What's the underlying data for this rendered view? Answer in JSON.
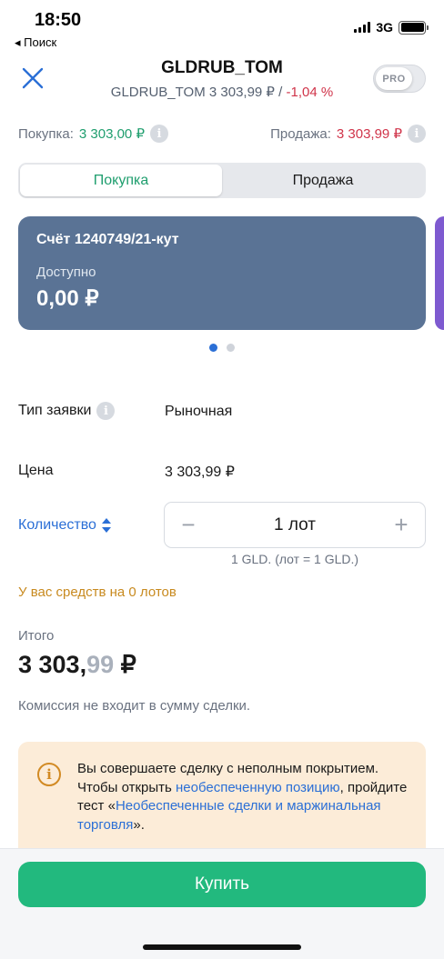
{
  "status_bar": {
    "time": "18:50",
    "back": "◂ Поиск",
    "network": "3G"
  },
  "header": {
    "title": "GLDRUB_TOM",
    "subtitle_main": "GLDRUB_TOM 3 303,99 ₽ / ",
    "subtitle_change": "-1,04 %",
    "pro_label": "PRO",
    "close_icon": "close-icon"
  },
  "prices": {
    "buy_label": "Покупка:",
    "buy_value": "3 303,00 ₽",
    "sell_label": "Продажа:",
    "sell_value": "3 303,99 ₽",
    "info_glyph": "i"
  },
  "tabs": [
    {
      "label": "Покупка",
      "active": true
    },
    {
      "label": "Продажа",
      "active": false
    }
  ],
  "account": {
    "name": "Счёт 1240749/21-кут",
    "available_label": "Доступно",
    "available_value": "0,00 ₽"
  },
  "order": {
    "type_label": "Тип заявки",
    "type_value": "Рыночная",
    "price_label": "Цена",
    "price_value": "3 303,99 ₽",
    "qty_label": "Количество",
    "qty_minus": "−",
    "qty_value": "1 лот",
    "qty_plus": "+",
    "lot_note": "1 GLD. (лот = 1 GLD.)",
    "funds_warning": "У вас средств на 0 лотов"
  },
  "total": {
    "label": "Итого",
    "amount_int": "3 303,",
    "amount_frac": "99",
    "currency": " ₽",
    "commission": "Комиссия не входит в сумму сделки."
  },
  "notice": {
    "glyph": "i",
    "text_1": "Вы совершаете сделку с неполным покрытием. Чтобы открыть ",
    "link_1": "необеспеченную позицию",
    "text_2": ", пройдите тест «",
    "link_2": "Необеспеченные сделки и маржинальная торговля",
    "text_3": "»."
  },
  "action": {
    "buy_button": "Купить"
  },
  "colors": {
    "accent_green": "#22b97e",
    "negative_red": "#d0344a",
    "link_blue": "#2b6fd6",
    "card_bg": "#5a7395",
    "warning_orange": "#c88a1f"
  }
}
